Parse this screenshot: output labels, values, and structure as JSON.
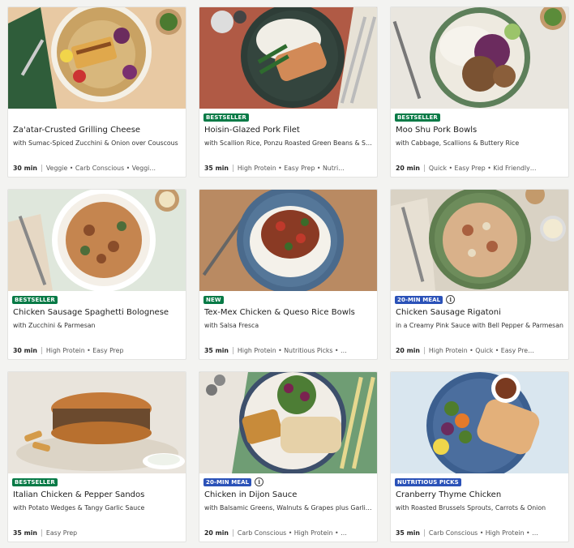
{
  "recipes": [
    {
      "title": "Za'atar-Crusted Grilling Cheese",
      "subtitle": "with Sumac-Spiced Zucchini & Onion over Couscous",
      "time": "30 min",
      "tags": "Veggie • Carb Conscious • Veggi…",
      "badge": "",
      "badge_color": "",
      "info": false
    },
    {
      "title": "Hoisin-Glazed Pork Filet",
      "subtitle": "with Scallion Rice, Ponzu Roasted Green Beans & Sr…",
      "time": "35 min",
      "tags": "High Protein • Easy Prep • Nutri…",
      "badge": "BESTSELLER",
      "badge_color": "#067a46",
      "info": false
    },
    {
      "title": "Moo Shu Pork Bowls",
      "subtitle": "with Cabbage, Scallions & Buttery Rice",
      "time": "20 min",
      "tags": "Quick • Easy Prep • Kid Friendly…",
      "badge": "BESTSELLER",
      "badge_color": "#067a46",
      "info": false
    },
    {
      "title": "Chicken Sausage Spaghetti Bolognese",
      "subtitle": "with Zucchini & Parmesan",
      "time": "30 min",
      "tags": "High Protein • Easy Prep",
      "badge": "BESTSELLER",
      "badge_color": "#067a46",
      "info": false
    },
    {
      "title": "Tex-Mex Chicken & Queso Rice Bowls",
      "subtitle": "with Salsa Fresca",
      "time": "35 min",
      "tags": "High Protein • Nutritious Picks • …",
      "badge": "NEW",
      "badge_color": "#067a46",
      "info": false
    },
    {
      "title": "Chicken Sausage Rigatoni",
      "subtitle": "in a Creamy Pink Sauce with Bell Pepper & Parmesan",
      "time": "20 min",
      "tags": "High Protein • Quick • Easy Pre…",
      "badge": "20-MIN MEAL",
      "badge_color": "#2b52b8",
      "info": true
    },
    {
      "title": "Italian Chicken & Pepper Sandos",
      "subtitle": "with Potato Wedges & Tangy Garlic Sauce",
      "time": "35 min",
      "tags": "Easy Prep",
      "badge": "BESTSELLER",
      "badge_color": "#067a46",
      "info": false
    },
    {
      "title": "Chicken in Dijon Sauce",
      "subtitle": "with Balsamic Greens, Walnuts & Grapes plus Garlic…",
      "time": "20 min",
      "tags": "Carb Conscious • High Protein • …",
      "badge": "20-MIN MEAL",
      "badge_color": "#2b52b8",
      "info": true
    },
    {
      "title": "Cranberry Thyme Chicken",
      "subtitle": "with Roasted Brussels Sprouts, Carrots & Onion",
      "time": "35 min",
      "tags": "Carb Conscious • High Protein • …",
      "badge": "NUTRITIOUS PICKS",
      "badge_color": "#2b52b8",
      "info": false
    }
  ],
  "info_icon_glyph": "i",
  "photo_icons": [
    "couscous-plate-photo",
    "pork-rice-plate-photo",
    "pork-bowl-photo",
    "spaghetti-bowl-photo",
    "rice-bowl-photo",
    "rigatoni-bowl-photo",
    "sandwich-photo",
    "chicken-salad-plate-photo",
    "chicken-veggie-plate-photo"
  ],
  "photo_bg_colors": [
    "#e8c9a3",
    "#b05a45",
    "#e9e6df",
    "#dfe7dc",
    "#b98a62",
    "#d9d2c4",
    "#e9e4dc",
    "#6f9d74",
    "#d9e6ef"
  ]
}
